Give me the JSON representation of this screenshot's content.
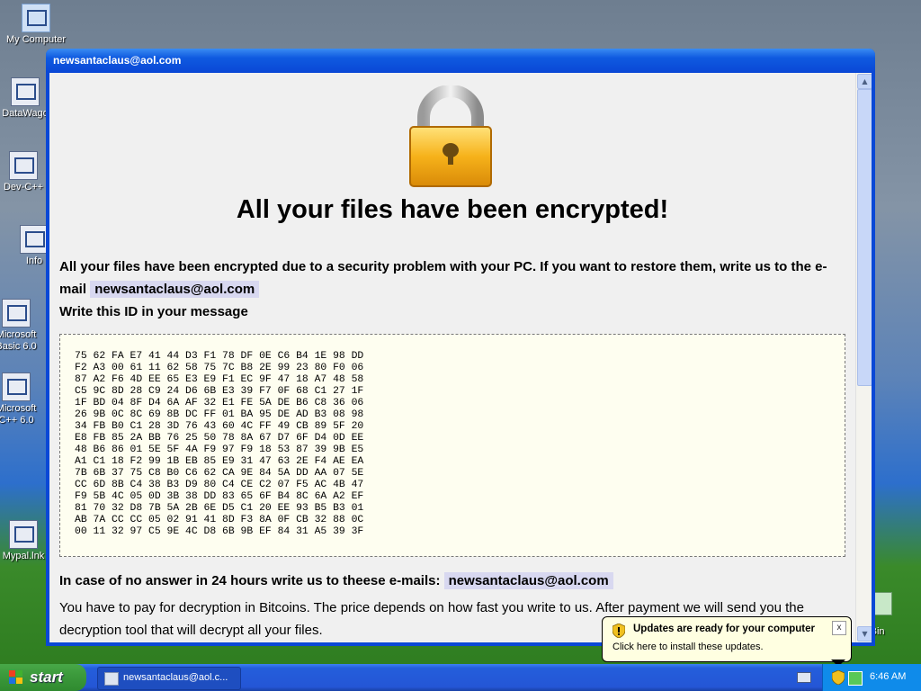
{
  "desktop": {
    "icons": [
      {
        "label": "My Computer"
      },
      {
        "label": "DataWago"
      },
      {
        "label": "Dev-C++"
      },
      {
        "label": "Info"
      },
      {
        "label": "Microsoft Basic 6.0"
      },
      {
        "label": "Microsoft C++ 6.0"
      },
      {
        "label": "Mypal.lnk"
      }
    ],
    "recycle_label": "le Bin"
  },
  "window": {
    "title": "newsantaclaus@aol.com",
    "headline": "All your files have been encrypted!",
    "para1_text": "All your files have been encrypted due to a security problem with your PC. If you want to restore them, write us to the e-mail",
    "email": "newsantaclaus@aol.com",
    "id_prompt": "Write this ID in your message",
    "id_block": "75 62 FA E7 41 44 D3 F1 78 DF 0E C6 B4 1E 98 DD\nF2 A3 00 61 11 62 58 75 7C B8 2E 99 23 80 F0 06\n87 A2 F6 4D EE 65 E3 E9 F1 EC 9F 47 18 A7 48 58\nC5 9C 8D 28 C9 24 D6 6B E3 39 F7 0F 68 C1 27 1F\n1F BD 04 8F D4 6A AF 32 E1 FE 5A DE B6 C8 36 06\n26 9B 0C 8C 69 8B DC FF 01 BA 95 DE AD B3 08 98\n34 FB B0 C1 28 3D 76 43 60 4C FF 49 CB 89 5F 20\nE8 FB 85 2A BB 76 25 50 78 8A 67 D7 6F D4 0D EE\n48 B6 86 01 5E 5F 4A F9 97 F9 18 53 87 39 9B E5\nA1 C1 18 F2 99 1B EB 85 E9 31 47 63 2E F4 AE EA\n7B 6B 37 75 C8 B0 C6 62 CA 9E 84 5A DD AA 07 5E\nCC 6D 8B C4 38 B3 D9 80 C4 CE C2 07 F5 AC 4B 47\nF9 5B 4C 05 0D 3B 38 DD 83 65 6F B4 8C 6A A2 EF\n81 70 32 D8 7B 5A 2B 6E D5 C1 20 EE 93 B5 B3 01\nAB 7A CC CC 05 02 91 41 8D F3 8A 0F CB 32 88 0C\n00 11 32 97 C5 9E 4C D8 6B 9B EF 84 31 A5 39 3F",
    "no_answer_text": "In case of no answer in 24 hours write us to theese e-mails:",
    "no_answer_email": "newsantaclaus@aol.com",
    "payment_text": "You have to pay for decryption in Bitcoins. The price depends on how fast you write to us. After payment we will send you the decryption tool that will decrypt all your files."
  },
  "taskbar": {
    "start_label": "start",
    "task_button_label": "newsantaclaus@aol.c...",
    "clock": "6:46 AM"
  },
  "balloon": {
    "title": "Updates are ready for your computer",
    "text": "Click here to install these updates.",
    "close": "x"
  },
  "colors": {
    "title_bar": "#0a48d6",
    "email_highlight": "#d8d8f0",
    "id_box_bg": "#fefef0",
    "taskbar": "#245edb",
    "start_button": "#3c9a3c",
    "balloon_bg": "#ffffe1"
  },
  "icons": {
    "lock": "padlock-icon",
    "shield": "security-shield-icon",
    "flag": "windows-flag-icon"
  }
}
